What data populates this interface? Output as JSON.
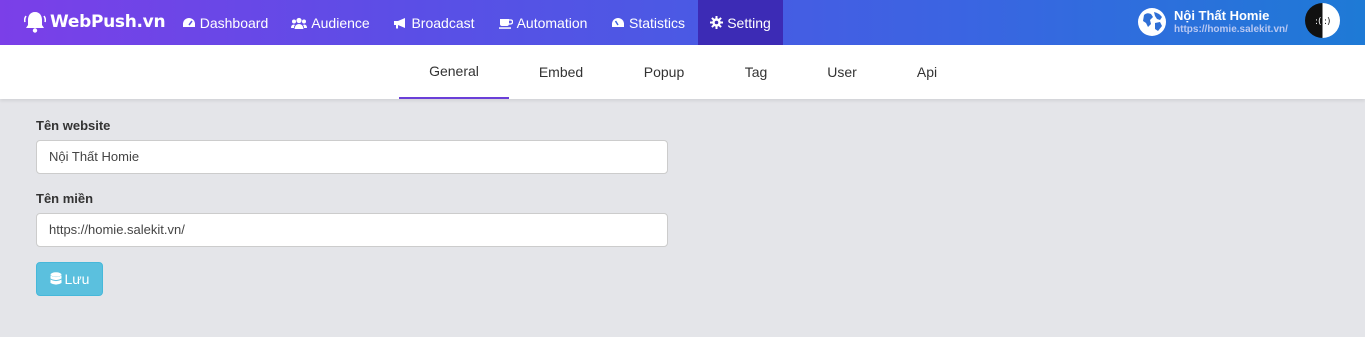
{
  "app": {
    "logo_text": "WebPush.vn"
  },
  "nav": {
    "items": [
      {
        "label": "Dashboard",
        "icon": "dashboard-icon"
      },
      {
        "label": "Audience",
        "icon": "users-icon"
      },
      {
        "label": "Broadcast",
        "icon": "bullhorn-icon"
      },
      {
        "label": "Automation",
        "icon": "coffee-icon"
      },
      {
        "label": "Statistics",
        "icon": "gauge-icon"
      },
      {
        "label": "Setting",
        "icon": "gear-icon",
        "active": true
      }
    ]
  },
  "site": {
    "name": "Nội Thất Homie",
    "url": "https://homie.salekit.vn/"
  },
  "tabs": [
    {
      "label": "General",
      "active": true
    },
    {
      "label": "Embed"
    },
    {
      "label": "Popup"
    },
    {
      "label": "Tag"
    },
    {
      "label": "User"
    },
    {
      "label": "Api"
    }
  ],
  "form": {
    "website_label": "Tên website",
    "website_value": "Nội Thất Homie",
    "domain_label": "Tên miền",
    "domain_value": "https://homie.salekit.vn/",
    "save_label": "Lưu"
  },
  "colors": {
    "accent": "#6a3fd8",
    "active_nav": "#3c2bb5",
    "save_button": "#5bc0de",
    "background": "#e4e5e9"
  }
}
